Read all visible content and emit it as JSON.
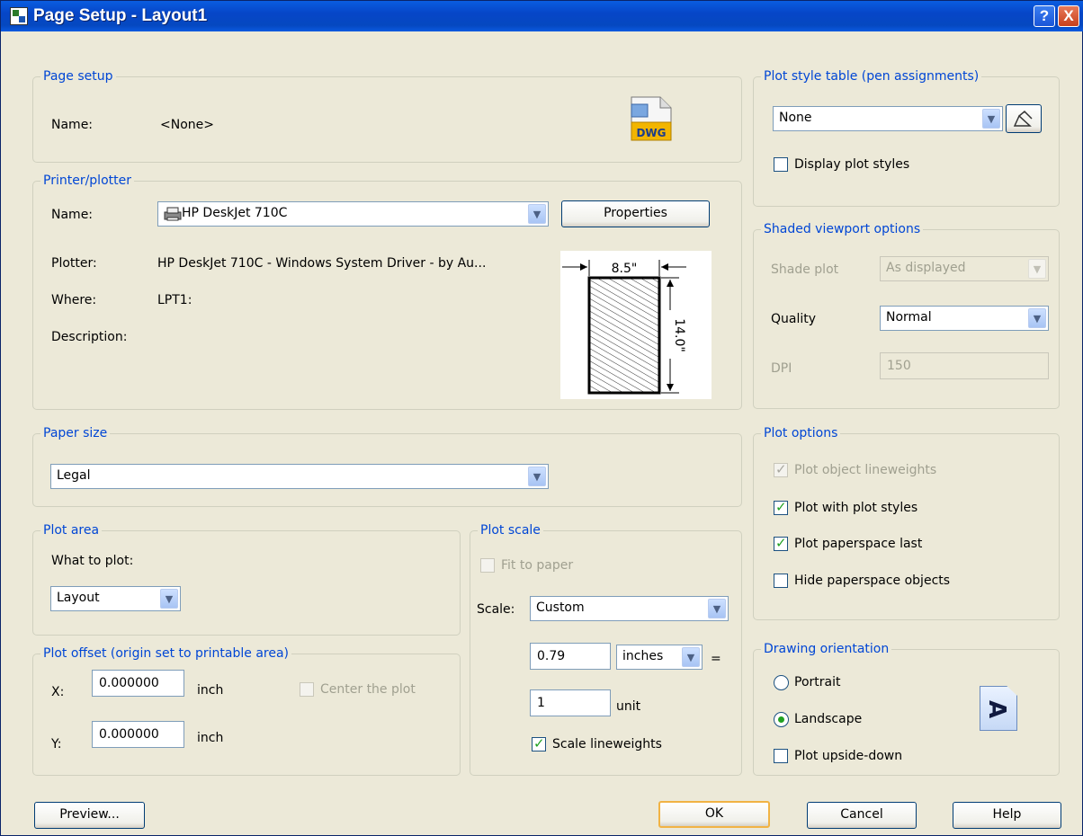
{
  "window": {
    "title": "Page Setup - Layout1",
    "help_btn": "?",
    "close_btn": "X"
  },
  "page_setup": {
    "legend": "Page setup",
    "name_label": "Name:",
    "name_value": "<None>",
    "icon_text": "DWG"
  },
  "printer": {
    "legend": "Printer/plotter",
    "name_label": "Name:",
    "name_value": "HP DeskJet 710C",
    "properties_btn": "Properties",
    "plotter_label": "Plotter:",
    "plotter_value": "HP DeskJet 710C - Windows System Driver - by Au...",
    "where_label": "Where:",
    "where_value": "LPT1:",
    "description_label": "Description:",
    "paper_width": "8.5\"",
    "paper_height": "14.0\""
  },
  "paper_size": {
    "legend": "Paper size",
    "value": "Legal"
  },
  "plot_area": {
    "legend": "Plot area",
    "what_label": "What to plot:",
    "value": "Layout"
  },
  "plot_offset": {
    "legend": "Plot offset (origin set to printable area)",
    "x_label": "X:",
    "x_value": "0.000000",
    "x_unit": "inch",
    "y_label": "Y:",
    "y_value": "0.000000",
    "y_unit": "inch",
    "center_label": "Center the plot"
  },
  "plot_scale": {
    "legend": "Plot scale",
    "fit_label": "Fit to paper",
    "scale_label": "Scale:",
    "scale_value": "Custom",
    "value1": "0.79",
    "unit1": "inches",
    "equals": "=",
    "value2": "1",
    "unit2": "unit",
    "lineweights_label": "Scale lineweights"
  },
  "plot_style": {
    "legend": "Plot style table (pen assignments)",
    "value": "None",
    "display_label": "Display plot styles"
  },
  "shaded": {
    "legend": "Shaded viewport options",
    "shade_label": "Shade plot",
    "shade_value": "As displayed",
    "quality_label": "Quality",
    "quality_value": "Normal",
    "dpi_label": "DPI",
    "dpi_value": "150"
  },
  "plot_options": {
    "legend": "Plot options",
    "opt1": "Plot object lineweights",
    "opt2": "Plot with plot styles",
    "opt3": "Plot paperspace last",
    "opt4": "Hide paperspace objects"
  },
  "orientation": {
    "legend": "Drawing orientation",
    "portrait": "Portrait",
    "landscape": "Landscape",
    "upside": "Plot upside-down",
    "icon_glyph": "A"
  },
  "buttons": {
    "preview": "Preview...",
    "ok": "OK",
    "cancel": "Cancel",
    "help": "Help"
  }
}
